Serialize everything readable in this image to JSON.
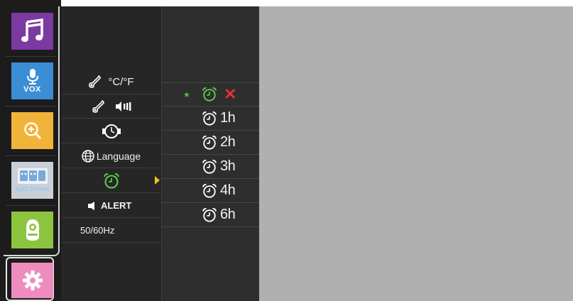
{
  "sidebar": {
    "apps": [
      {
        "name": "music",
        "icon": "music-note-icon"
      },
      {
        "name": "vox",
        "icon": "microphone-icon",
        "label": "VOX"
      },
      {
        "name": "zoom",
        "icon": "zoom-in-icon"
      },
      {
        "name": "split-screen",
        "icon": "split-screen-icon",
        "label": "Split Screen"
      },
      {
        "name": "camera",
        "icon": "baby-camera-icon"
      },
      {
        "name": "settings",
        "icon": "gear-icon"
      }
    ]
  },
  "menu": {
    "temperature_unit": "°C/°F",
    "language": "Language",
    "alert": "ALERT",
    "frequency": "50/60Hz"
  },
  "timer": {
    "options": [
      "1h",
      "2h",
      "3h",
      "4h",
      "6h"
    ]
  },
  "colors": {
    "music": "#7b3aa2",
    "vox": "#3c8ed4",
    "zoom": "#f2b33a",
    "split": "#c9d0da",
    "camera": "#8dc43f",
    "settings": "#ee8dbd",
    "accent_green": "#5bd24a",
    "cancel_red": "#e53030",
    "arrow_yellow": "#f2c21a"
  }
}
